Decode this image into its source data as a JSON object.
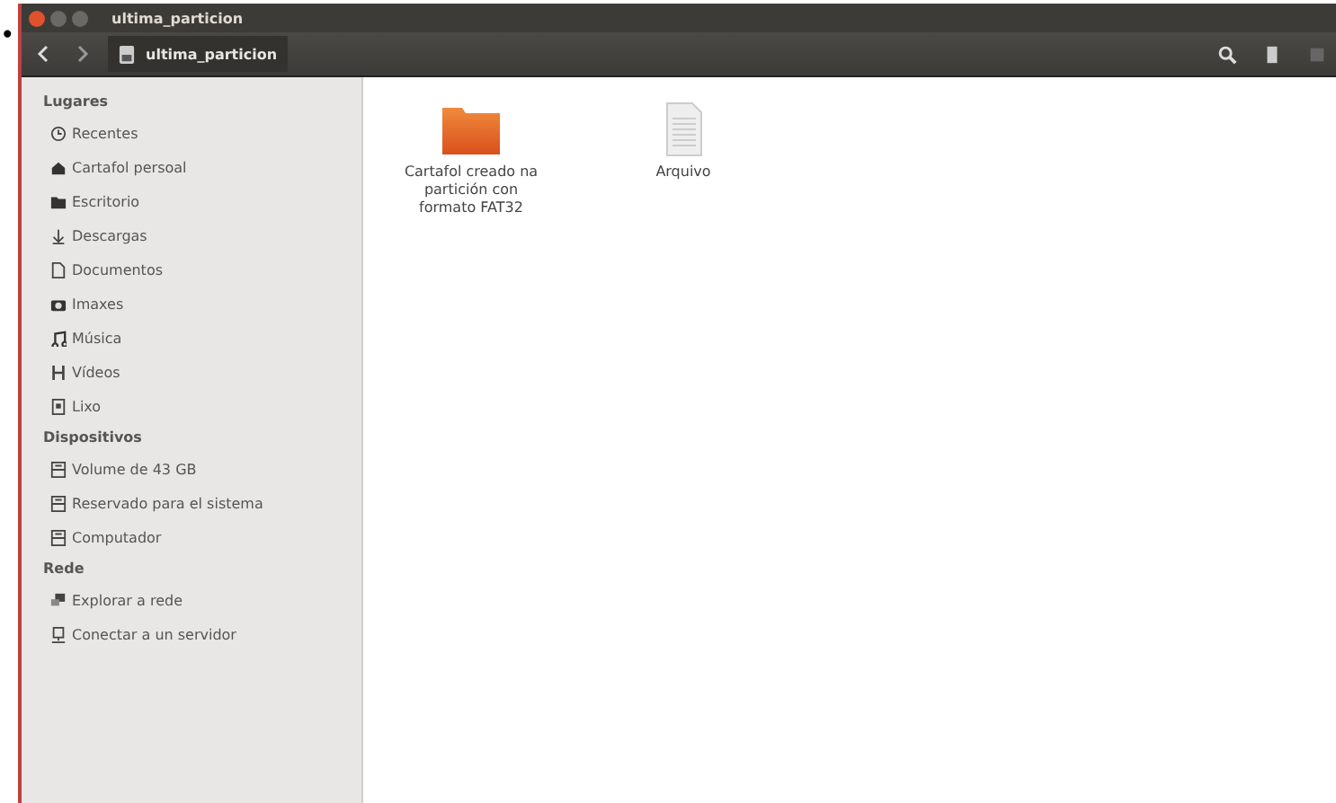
{
  "bullet": "•",
  "window": {
    "title": "ultima_particion"
  },
  "toolbar": {
    "path": "ultima_particion"
  },
  "sidebar": {
    "sections": [
      {
        "heading": "Lugares",
        "items": [
          {
            "label": "Recentes",
            "kind": "clock"
          },
          {
            "label": "Cartafol persoal",
            "kind": "home"
          },
          {
            "label": "Escritorio",
            "kind": "folder"
          },
          {
            "label": "Descargas",
            "kind": "download"
          },
          {
            "label": "Documentos",
            "kind": "document"
          },
          {
            "label": "Imaxes",
            "kind": "camera"
          },
          {
            "label": "Música",
            "kind": "music"
          },
          {
            "label": "Vídeos",
            "kind": "film"
          },
          {
            "label": "Lixo",
            "kind": "trash"
          }
        ]
      },
      {
        "heading": "Dispositivos",
        "items": [
          {
            "label": "Volume de 43 GB",
            "kind": "drive"
          },
          {
            "label": "Reservado para el sistema",
            "kind": "drive"
          },
          {
            "label": "Computador",
            "kind": "drive"
          }
        ]
      },
      {
        "heading": "Rede",
        "items": [
          {
            "label": "Explorar a rede",
            "kind": "network"
          },
          {
            "label": "Conectar a un servidor",
            "kind": "server"
          }
        ]
      }
    ]
  },
  "files": [
    {
      "name": "Cartafol creado na partición con formato FAT32",
      "kind": "folder"
    },
    {
      "name": "Arquivo",
      "kind": "file"
    }
  ]
}
